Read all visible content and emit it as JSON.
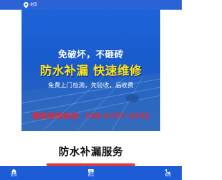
{
  "topbar": {
    "location_text": "全国"
  },
  "banner": {
    "headline": "免破坏，不砸砖",
    "slogan": "防水补漏 快速维修",
    "subline": "免费上门检测，先验收，后收费",
    "hotline": "服务热线电话：180-2727-3131"
  },
  "section": {
    "title": "防水补漏服务"
  },
  "bottom_nav": {
    "items": [
      {
        "label": "首页",
        "icon": "home-icon"
      },
      {
        "label": "留言",
        "icon": "message-icon"
      },
      {
        "label": "电话",
        "icon": "phone-icon"
      }
    ]
  },
  "colors": {
    "primary": "#1e5bd6",
    "accent_yellow": "#ffe21a",
    "hotline_red": "#ff1f1f",
    "underline": "#e23b3b"
  }
}
